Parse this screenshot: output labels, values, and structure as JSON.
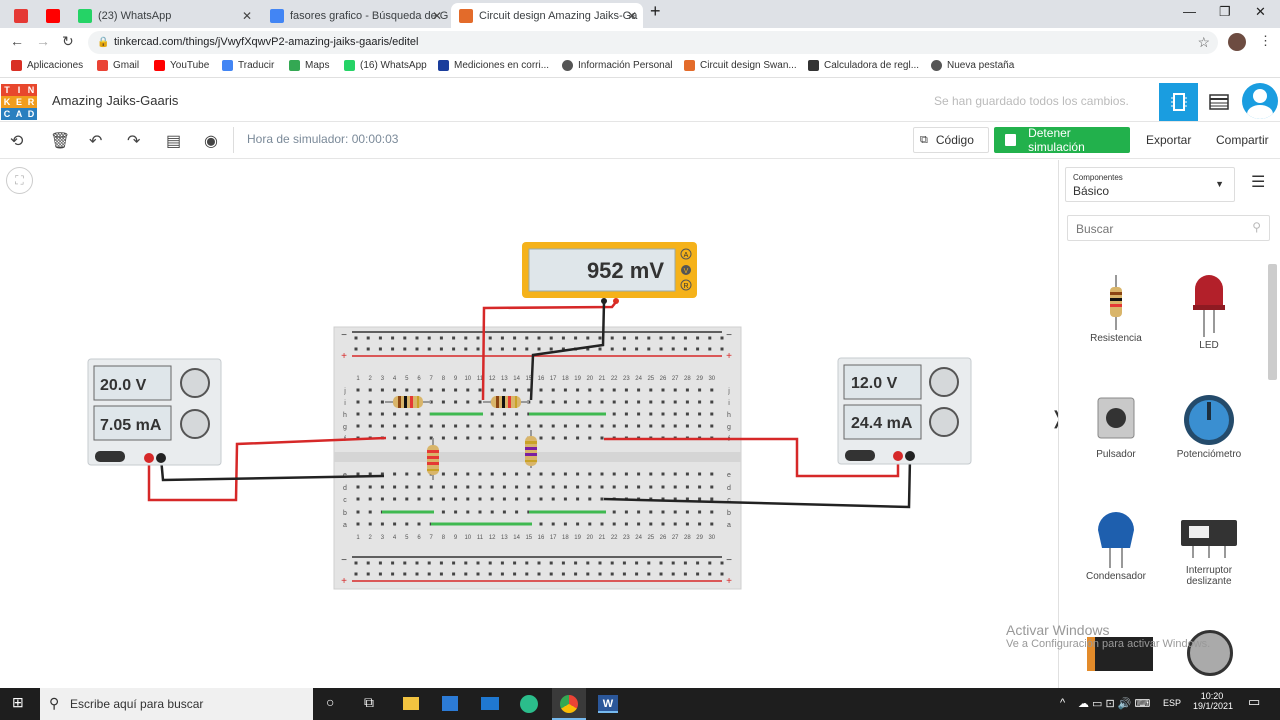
{
  "browser": {
    "tabs": [
      {
        "title": "",
        "fav": "#e53935"
      },
      {
        "title": "",
        "fav": "#ff0000"
      },
      {
        "title": "(23) WhatsApp",
        "fav": "#25d366"
      },
      {
        "title": "fasores grafico - Búsqueda de Go",
        "fav": "#4285f4"
      },
      {
        "title": "Circuit design Amazing Jaiks-Ga",
        "fav": "#e36b2a"
      }
    ],
    "url": "tinkercad.com/things/jVwyfXqwvP2-amazing-jaiks-gaaris/editel",
    "bookmarks": [
      {
        "label": "Aplicaciones",
        "color": "#d93025"
      },
      {
        "label": "Gmail",
        "color": "#ea4335"
      },
      {
        "label": "YouTube",
        "color": "#ff0000"
      },
      {
        "label": "Traducir",
        "color": "#4285f4"
      },
      {
        "label": "Maps",
        "color": "#34a853"
      },
      {
        "label": "(16) WhatsApp",
        "color": "#25d366"
      },
      {
        "label": "Mediciones en corri...",
        "color": "#1a3d9c"
      },
      {
        "label": "Información Personal",
        "color": "#555555"
      },
      {
        "label": "Circuit design Swan...",
        "color": "#e36b2a"
      },
      {
        "label": "Calculadora de regl...",
        "color": "#333333"
      },
      {
        "label": "Nueva pestaña",
        "color": "#555555"
      }
    ]
  },
  "app": {
    "logo": [
      "T",
      "I",
      "N",
      "K",
      "E",
      "R",
      "C",
      "A",
      "D"
    ],
    "project_name": "Amazing Jaiks-Gaaris",
    "saved_status": "Se han guardado todos los cambios.",
    "sim_time": "Hora de simulador: 00:00:03",
    "code_label": "Código",
    "stop_label": "Detener simulación",
    "export_label": "Exportar",
    "share_label": "Compartir"
  },
  "circuit": {
    "multimeter": {
      "reading": "952 mV",
      "modes": [
        "A",
        "V",
        "R"
      ]
    },
    "left_supply": {
      "voltage": "20.0 V",
      "current": "7.05 mA"
    },
    "right_supply": {
      "voltage": "12.0 V",
      "current": "24.4 mA"
    },
    "breadboard": {
      "columns": [
        "1",
        "2",
        "3",
        "4",
        "5",
        "6",
        "7",
        "8",
        "9",
        "10",
        "11",
        "12",
        "13",
        "14",
        "15",
        "16",
        "17",
        "18",
        "19",
        "20",
        "21",
        "22",
        "23",
        "24",
        "25",
        "26",
        "27",
        "28",
        "29",
        "30"
      ],
      "rows_top": [
        "j",
        "i",
        "h",
        "g",
        "f"
      ],
      "rows_bottom": [
        "e",
        "d",
        "c",
        "b",
        "a"
      ]
    }
  },
  "panel": {
    "dropdown_caption": "Componentes",
    "dropdown_value": "Básico",
    "search_placeholder": "Buscar",
    "components": [
      {
        "label": "Resistencia"
      },
      {
        "label": "LED"
      },
      {
        "label": "Pulsador"
      },
      {
        "label": "Potenciómetro"
      },
      {
        "label": "Condensador"
      },
      {
        "label": "Interruptor deslizante"
      }
    ]
  },
  "watermark": {
    "title": "Activar Windows",
    "subtitle": "Ve a Configuración para activar Windows."
  },
  "taskbar": {
    "search_text": "Escribe aquí para buscar",
    "lang": "ESP",
    "time": "10:20",
    "date": "19/1/2021"
  }
}
